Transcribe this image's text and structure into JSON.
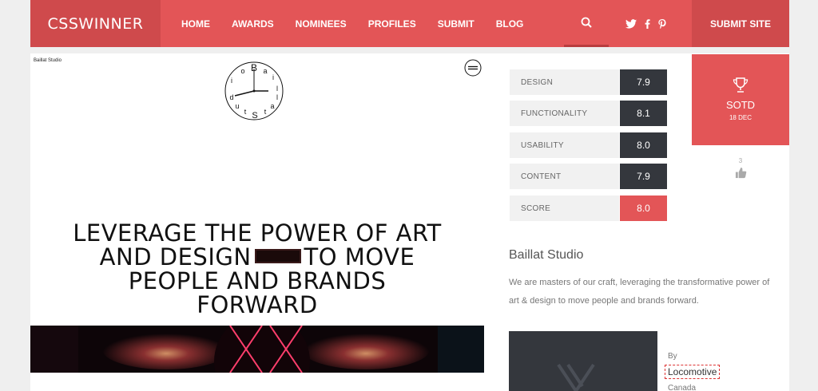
{
  "header": {
    "logo": "CSSWINNER",
    "nav": [
      "HOME",
      "AWARDS",
      "NOMINEES",
      "PROFILES",
      "SUBMIT",
      "BLOG"
    ],
    "submit_site": "SUBMIT SITE",
    "social_icons": [
      "twitter-icon",
      "facebook-icon",
      "pinterest-icon"
    ]
  },
  "preview": {
    "label": "Baillat Studio",
    "clock_letters": [
      "B",
      "a",
      "i",
      "l",
      "l",
      "a",
      "t",
      "S",
      "t",
      "u",
      "d",
      "i",
      "o"
    ],
    "headline_line1": "LEVERAGE THE POWER OF ART",
    "headline_line2a": "AND DESIGN",
    "headline_line2b": "TO MOVE",
    "headline_line3": "PEOPLE AND BRANDS",
    "headline_line4": "FORWARD"
  },
  "scores": [
    {
      "label": "DESIGN",
      "value": "7.9"
    },
    {
      "label": "FUNCTIONALITY",
      "value": "8.1"
    },
    {
      "label": "USABILITY",
      "value": "8.0"
    },
    {
      "label": "CONTENT",
      "value": "7.9"
    },
    {
      "label": "SCORE",
      "value": "8.0"
    }
  ],
  "sotd": {
    "label": "SOTD",
    "date": "18 DEC"
  },
  "likes": {
    "count": "3"
  },
  "site": {
    "title": "Baillat Studio",
    "description": "We are masters of our craft, leveraging the transformative power of art & design to move people and brands forward.",
    "by_label": "By",
    "author": "Locomotive",
    "country": "Canada"
  },
  "colors": {
    "accent": "#e35557",
    "dark": "#34373d"
  }
}
